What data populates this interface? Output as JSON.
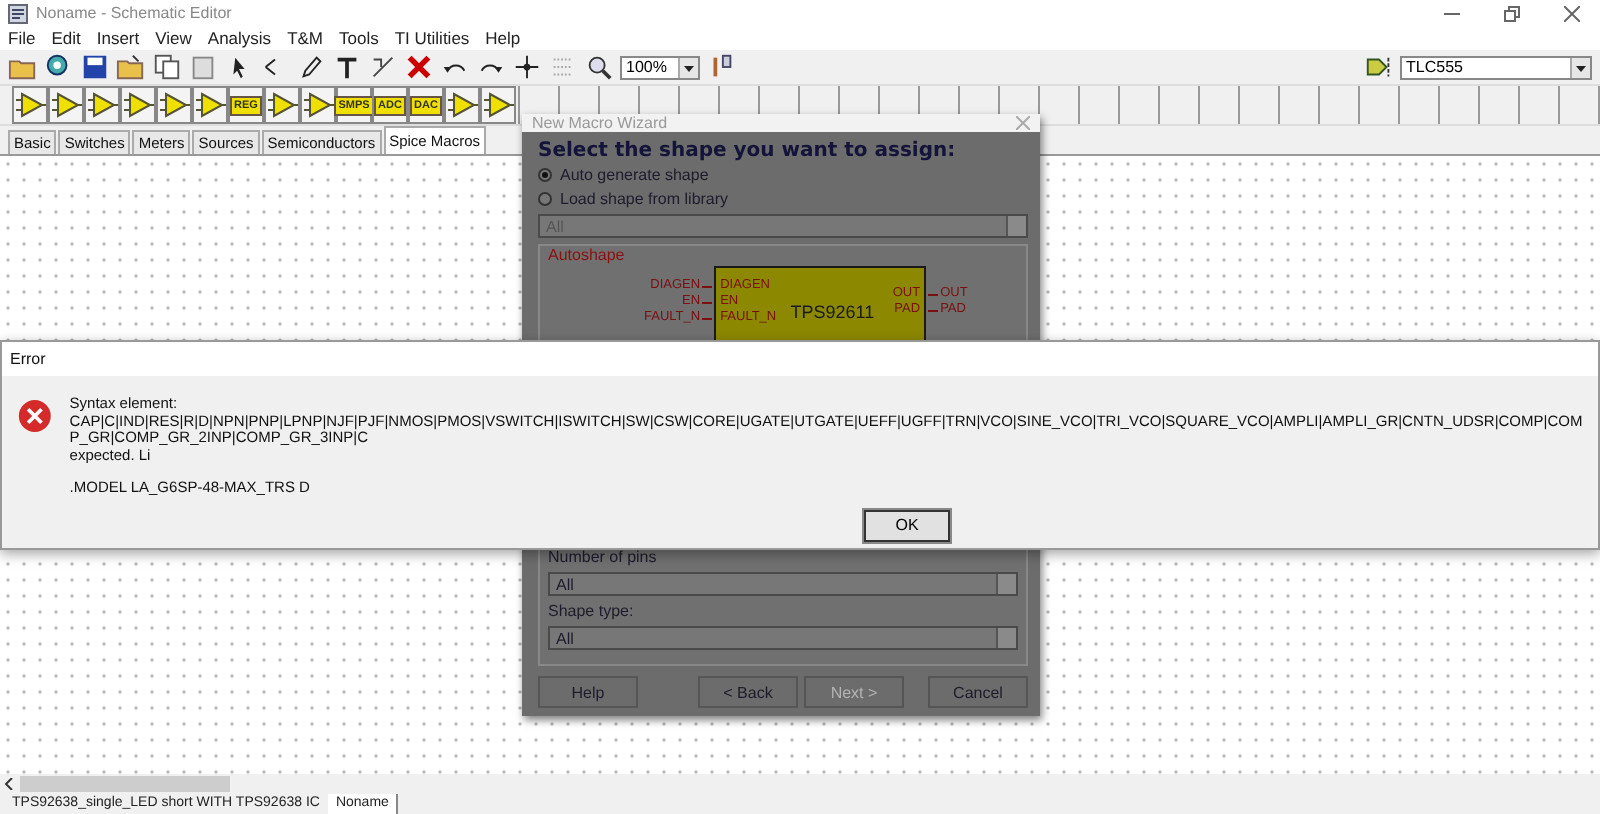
{
  "window": {
    "title": "Noname - Schematic Editor"
  },
  "menu": [
    "File",
    "Edit",
    "Insert",
    "View",
    "Analysis",
    "T&M",
    "Tools",
    "TI Utilities",
    "Help"
  ],
  "toolbar": {
    "zoom": "100%",
    "component": "TLC555"
  },
  "component_toolbar": [
    {
      "kind": "symbol"
    },
    {
      "kind": "symbol"
    },
    {
      "kind": "symbol"
    },
    {
      "kind": "symbol"
    },
    {
      "kind": "symbol"
    },
    {
      "kind": "symbol"
    },
    {
      "kind": "labeled",
      "label": "REG"
    },
    {
      "kind": "symbol"
    },
    {
      "kind": "symbol"
    },
    {
      "kind": "labeled",
      "label": "SMPS"
    },
    {
      "kind": "labeled",
      "label": "ADC"
    },
    {
      "kind": "labeled",
      "label": "DAC"
    },
    {
      "kind": "symbol"
    },
    {
      "kind": "symbol"
    }
  ],
  "tabs": [
    {
      "label": "Basic",
      "selected": false
    },
    {
      "label": "Switches",
      "selected": false
    },
    {
      "label": "Meters",
      "selected": false
    },
    {
      "label": "Sources",
      "selected": false
    },
    {
      "label": "Semiconductors",
      "selected": false
    },
    {
      "label": "Spice Macros",
      "selected": true
    }
  ],
  "wizard": {
    "title": "New Macro Wizard",
    "heading": "Select the shape you want to assign:",
    "options": [
      {
        "label": "Auto generate shape",
        "selected": true
      },
      {
        "label": "Load shape from library",
        "selected": false
      }
    ],
    "library": {
      "value": "All",
      "disabled": true
    },
    "preview": {
      "title": "Autoshape",
      "part": "TPS92611",
      "left_pins": [
        {
          "net": "DIAGEN",
          "pin": "DIAGEN"
        },
        {
          "net": "EN",
          "pin": "EN"
        },
        {
          "net": "FAULT_N",
          "pin": "FAULT_N"
        }
      ],
      "right_pins": [
        {
          "net": "OUT",
          "pin": "OUT"
        },
        {
          "net": "PAD",
          "pin": "PAD"
        }
      ]
    },
    "pins_label": "Number of pins",
    "pins": {
      "value": "All"
    },
    "shape_label": "Shape type:",
    "shape": {
      "value": "All"
    },
    "buttons": [
      {
        "label": "Help",
        "disabled": false
      },
      {
        "label": "< Back",
        "disabled": false
      },
      {
        "label": "Next >",
        "disabled": true
      },
      {
        "label": "Cancel",
        "disabled": false
      }
    ]
  },
  "error": {
    "title": "Error",
    "lines": [
      "Syntax element:",
      "CAP|C|IND|RES|R|D|NPN|PNP|LPNP|NJF|PJF|NMOS|PMOS|VSWITCH|ISWITCH|SW|CSW|CORE|UGATE|UTGATE|UEFF|UGFF|TRN|VCO|SINE_VCO|TRI_VCO|SQUARE_VCO|AMPLI|AMPLI_GR|CNTN_UDSR|COMP|COMP_GR|COMP_GR_2INP|COMP_GR_3INP|C",
      "expected. Li"
    ],
    "detail": ".MODEL LA_G6SP-48-MAX_TRS D",
    "button": "OK"
  },
  "status_bar": {
    "tabs": [
      {
        "label": "TPS92638_single_LED short WITH TPS92638 IC",
        "selected": false
      },
      {
        "label": "Noname",
        "selected": true
      }
    ]
  }
}
